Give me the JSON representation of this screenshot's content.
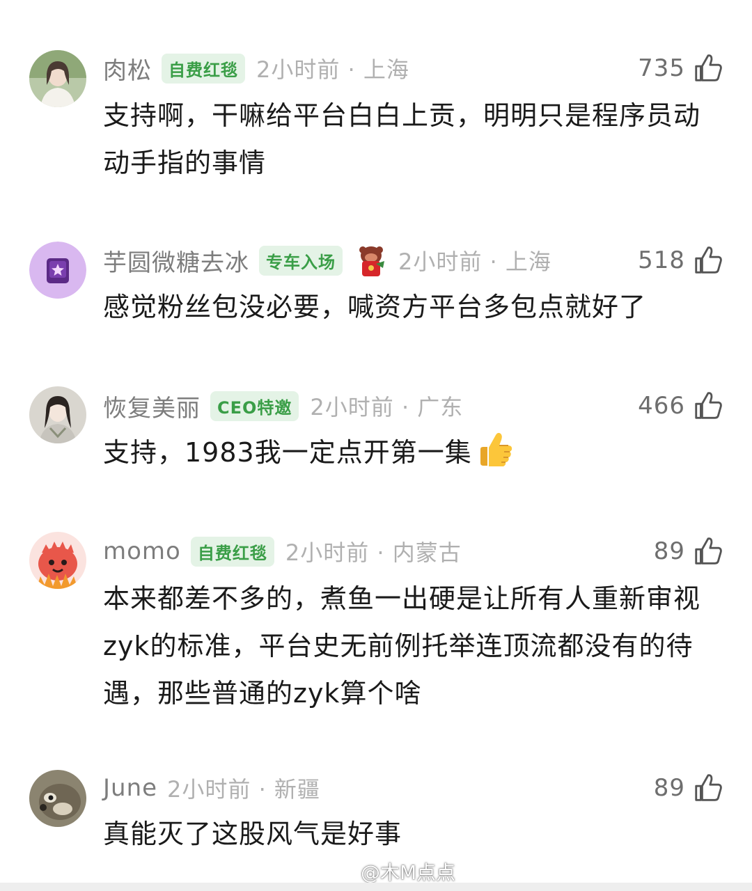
{
  "colors": {
    "badge_text": "#3a9e47",
    "badge_bg": "#e4f3e6",
    "username": "#7d7d7d",
    "time": "#b0b0b0",
    "body_text": "#1a1a1a"
  },
  "comments": [
    {
      "username": "肉松",
      "badge": "自费红毯",
      "time_location": "2小时前 · 上海",
      "likes": "735",
      "text": "支持啊，干嘛给平台白白上贡，明明只是程序员动动手指的事情",
      "like_icon": "thumbs-up-icon"
    },
    {
      "username": "芋圆微糖去冰",
      "badge": "专车入场",
      "sticker_icon": "red-envelope-sticker-icon",
      "time_location": "2小时前 · 上海",
      "likes": "518",
      "text": "感觉粉丝包没必要，喊资方平台多包点就好了",
      "like_icon": "thumbs-up-icon"
    },
    {
      "username": "恢复美丽",
      "badge": "CEO特邀",
      "time_location": "2小时前 · 广东",
      "likes": "466",
      "text": "支持，1983我一定点开第一集",
      "emoji": "thumbs-up-emoji",
      "like_icon": "thumbs-up-icon"
    },
    {
      "username": "momo",
      "badge": "自费红毯",
      "time_location": "2小时前 · 内蒙古",
      "likes": "89",
      "text": "本来都差不多的，煮鱼一出硬是让所有人重新审视zyk的标准，平台史无前例托举连顶流都没有的待遇，那些普通的zyk算个啥",
      "like_icon": "thumbs-up-icon"
    },
    {
      "username": "June",
      "time_location": "2小时前 · 新疆",
      "likes": "89",
      "text": "真能灭了这股风气是好事",
      "like_icon": "thumbs-up-icon"
    }
  ],
  "watermark": {
    "text": "@木M点点",
    "icon": "weibo-logo-icon"
  }
}
